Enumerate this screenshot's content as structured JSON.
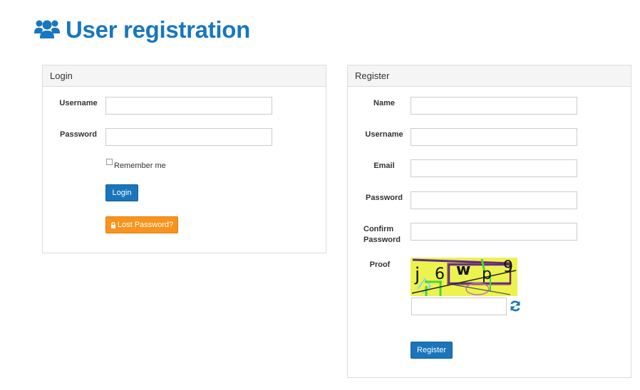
{
  "header": {
    "title": "User registration",
    "icon": "users-icon",
    "accent": "#1877be"
  },
  "login": {
    "title": "Login",
    "username_label": "Username",
    "username_value": "",
    "password_label": "Password",
    "password_value": "",
    "remember_label": "Remember me",
    "remember_checked": false,
    "login_button": "Login",
    "lost_password_button": "Lost Password?",
    "lost_password_icon": "lock-icon"
  },
  "register": {
    "title": "Register",
    "name_label": "Name",
    "name_value": "",
    "username_label": "Username",
    "username_value": "",
    "email_label": "Email",
    "email_value": "",
    "password_label": "Password",
    "password_value": "",
    "confirm_label_line1": "Confirm",
    "confirm_label_line2": "Password",
    "confirm_value": "",
    "proof_label": "Proof",
    "captcha_value": "",
    "captcha_refresh_icon": "refresh-icon",
    "register_button": "Register"
  },
  "colors": {
    "primary": "#1a75bb",
    "warning": "#f7941d"
  }
}
